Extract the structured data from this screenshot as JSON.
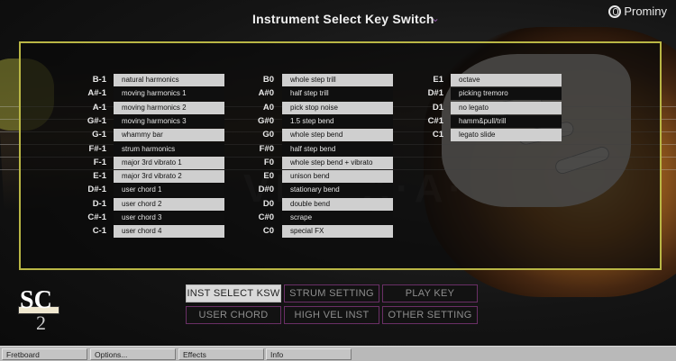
{
  "header": {
    "title": "Instrument Select Key Switch",
    "chevron": "⌄",
    "brand": "Prominy"
  },
  "columns": [
    {
      "rows": [
        {
          "key": "B-1",
          "label": "natural harmonics",
          "style": "light"
        },
        {
          "key": "A#-1",
          "label": "moving harmonics 1",
          "style": "dark"
        },
        {
          "key": "A-1",
          "label": "moving harmonics 2",
          "style": "light"
        },
        {
          "key": "G#-1",
          "label": "moving harmonics 3",
          "style": "dark"
        },
        {
          "key": "G-1",
          "label": "whammy bar",
          "style": "light"
        },
        {
          "key": "F#-1",
          "label": "strum harmonics",
          "style": "dark"
        },
        {
          "key": "F-1",
          "label": "major 3rd vibrato 1",
          "style": "light"
        },
        {
          "key": "E-1",
          "label": "major 3rd vibrato 2",
          "style": "light"
        },
        {
          "key": "D#-1",
          "label": "user chord 1",
          "style": "dark"
        },
        {
          "key": "D-1",
          "label": "user chord 2",
          "style": "light"
        },
        {
          "key": "C#-1",
          "label": "user chord 3",
          "style": "dark"
        },
        {
          "key": "C-1",
          "label": "user chord 4",
          "style": "light"
        }
      ]
    },
    {
      "rows": [
        {
          "key": "B0",
          "label": "whole step trill",
          "style": "light"
        },
        {
          "key": "A#0",
          "label": "half step trill",
          "style": "dark"
        },
        {
          "key": "A0",
          "label": "pick stop noise",
          "style": "light"
        },
        {
          "key": "G#0",
          "label": "1.5 step bend",
          "style": "dark"
        },
        {
          "key": "G0",
          "label": "whole step bend",
          "style": "light"
        },
        {
          "key": "F#0",
          "label": "half step bend",
          "style": "dark"
        },
        {
          "key": "F0",
          "label": "whole step bend + vibrato",
          "style": "light"
        },
        {
          "key": "E0",
          "label": "unison bend",
          "style": "light"
        },
        {
          "key": "D#0",
          "label": "stationary bend",
          "style": "dark"
        },
        {
          "key": "D0",
          "label": "double bend",
          "style": "light"
        },
        {
          "key": "C#0",
          "label": "scrape",
          "style": "dark"
        },
        {
          "key": "C0",
          "label": "special FX",
          "style": "light"
        }
      ]
    },
    {
      "rows": [
        {
          "key": "E1",
          "label": "octave",
          "style": "light"
        },
        {
          "key": "D#1",
          "label": "picking tremoro",
          "style": "dark"
        },
        {
          "key": "D1",
          "label": "no legato",
          "style": "light"
        },
        {
          "key": "C#1",
          "label": "hamm&pull/trill",
          "style": "dark"
        },
        {
          "key": "C1",
          "label": "legato slide",
          "style": "light"
        }
      ]
    }
  ],
  "buttons": [
    {
      "label": "INST SELECT KSW",
      "active": true
    },
    {
      "label": "STRUM SETTING",
      "active": false
    },
    {
      "label": "PLAY KEY",
      "active": false
    },
    {
      "label": "USER CHORD",
      "active": false
    },
    {
      "label": "HIGH VEL INST",
      "active": false
    },
    {
      "label": "OTHER SETTING",
      "active": false
    }
  ],
  "logo": {
    "text": "SC",
    "number": "2"
  },
  "taskbar": {
    "tabs": [
      "Fretboard",
      "Options...",
      "Effects",
      "Info"
    ]
  },
  "colors": {
    "panel_border": "#b9b645",
    "button_border": "#6a2f66",
    "active_button": "#d9d9d9"
  }
}
